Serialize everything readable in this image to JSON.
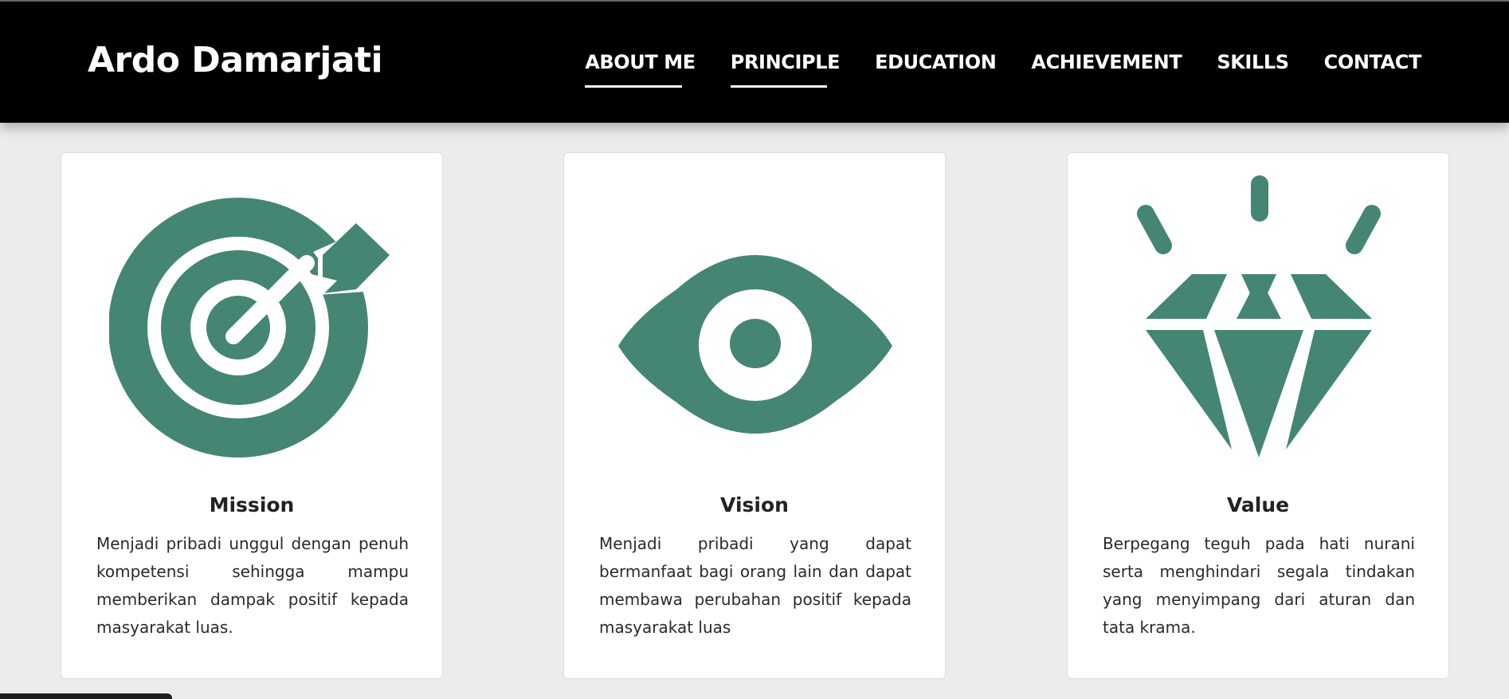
{
  "header": {
    "brand": "Ardo Damarjati",
    "nav": [
      {
        "label": "ABOUT ME",
        "active": true
      },
      {
        "label": "PRINCIPLE",
        "active": true
      },
      {
        "label": "EDUCATION",
        "active": false
      },
      {
        "label": "ACHIEVEMENT",
        "active": false
      },
      {
        "label": "SKILLS",
        "active": false
      },
      {
        "label": "CONTACT",
        "active": false
      }
    ]
  },
  "cards": [
    {
      "icon": "target-icon",
      "title": "Mission",
      "text": "Menjadi pribadi unggul dengan penuh kompetensi sehingga mampu memberikan dampak positif kepada masyarakat luas."
    },
    {
      "icon": "eye-icon",
      "title": "Vision",
      "text": "Menjadi pribadi yang dapat bermanfaat bagi orang lain dan dapat membawa perubahan positif kepada masyarakat luas"
    },
    {
      "icon": "diamond-icon",
      "title": "Value",
      "text": "Berpegang teguh pada hati nurani serta menghindari segala tindakan yang menyimpang dari aturan dan tata krama."
    }
  ],
  "colors": {
    "icon": "#448573",
    "navbar": "#000000",
    "background": "#ececec"
  }
}
